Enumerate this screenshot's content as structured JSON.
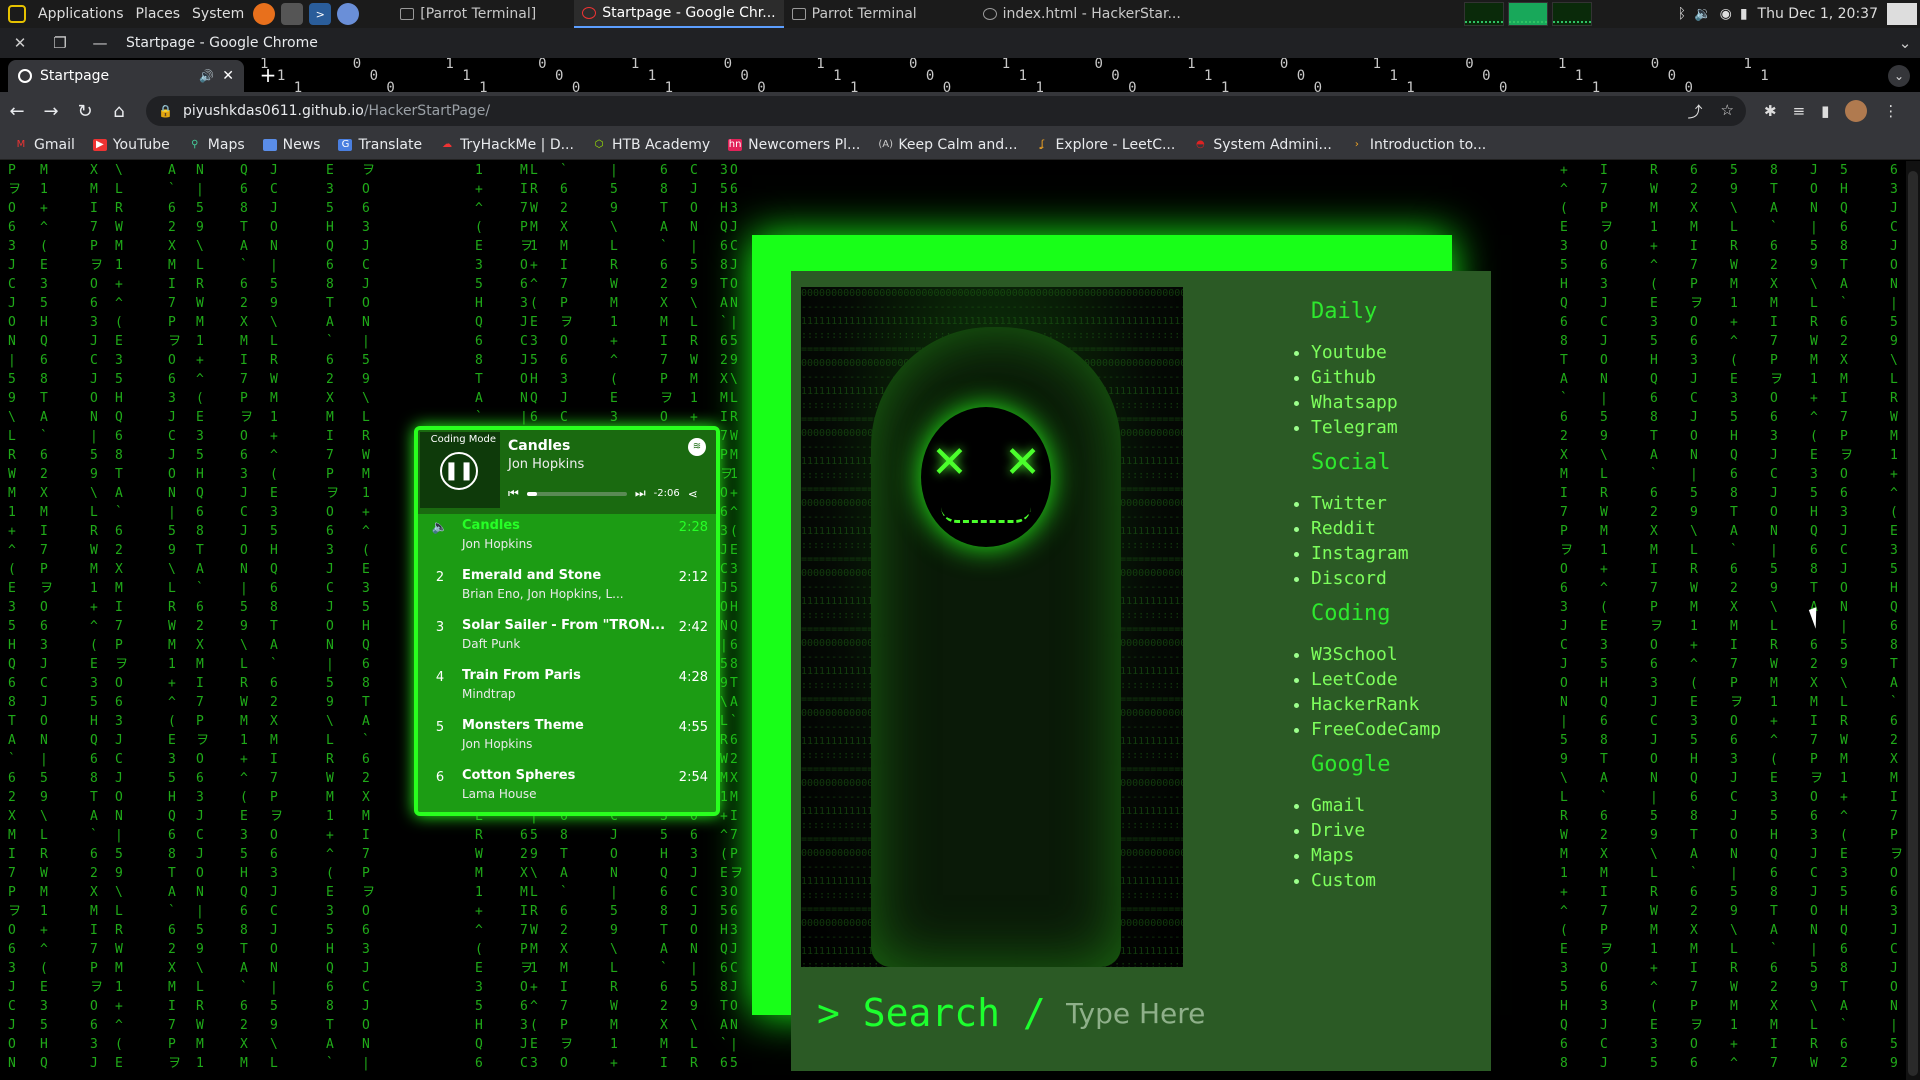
{
  "os_panel": {
    "menus": [
      "Applications",
      "Places",
      "System"
    ],
    "tasks": [
      {
        "label": "[Parrot Terminal]"
      },
      {
        "label": "Startpage - Google Chr..."
      },
      {
        "label": "Parrot Terminal"
      },
      {
        "label": "index.html - HackerStar..."
      }
    ],
    "clock": "Thu Dec 1, 20:37"
  },
  "chrome": {
    "window_title": "Startpage - Google Chrome",
    "tab_title": "Startpage",
    "url_host": "piyushkdas0611.github.io",
    "url_path": "/HackerStartPage/",
    "bookmarks": [
      "Gmail",
      "YouTube",
      "Maps",
      "News",
      "Translate",
      "TryHackMe | D...",
      "HTB Academy",
      "Newcomers Pl...",
      "Keep Calm and...",
      "Explore - LeetC...",
      "System Admini...",
      "Introduction to..."
    ]
  },
  "startpage": {
    "categories": [
      {
        "title": "Daily",
        "links": [
          "Youtube",
          "Github",
          "Whatsapp",
          "Telegram"
        ]
      },
      {
        "title": "Social",
        "links": [
          "Twitter",
          "Reddit",
          "Instagram",
          "Discord"
        ]
      },
      {
        "title": "Coding",
        "links": [
          "W3School",
          "LeetCode",
          "HackerRank",
          "FreeCodeCamp"
        ]
      },
      {
        "title": "Google",
        "links": [
          "Gmail",
          "Drive",
          "Maps",
          "Custom"
        ]
      }
    ],
    "search_prefix": "> Search /",
    "search_placeholder": "Type Here"
  },
  "player": {
    "cover_label": "Coding Mode",
    "now_playing_title": "Candles",
    "now_playing_artist": "Jon Hopkins",
    "remaining": "-2:06",
    "progress": 0.1,
    "tracks": [
      {
        "num": "",
        "title": "Candles",
        "artist": "Jon Hopkins",
        "duration": "2:28",
        "active": true
      },
      {
        "num": "2",
        "title": "Emerald and Stone",
        "artist": "Brian Eno, Jon Hopkins, L...",
        "duration": "2:12"
      },
      {
        "num": "3",
        "title": "Solar Sailer - From \"TRON...",
        "artist": "Daft Punk",
        "duration": "2:42"
      },
      {
        "num": "4",
        "title": "Train From Paris",
        "artist": "Mindtrap",
        "duration": "4:28"
      },
      {
        "num": "5",
        "title": "Monsters Theme",
        "artist": "Jon Hopkins",
        "duration": "4:55"
      },
      {
        "num": "6",
        "title": "Cotton Spheres",
        "artist": "Lama House",
        "duration": "2:54"
      }
    ]
  },
  "colors": {
    "matrix": "#26c81e",
    "glow": "#18ff18",
    "card_bg": "#2b5a25"
  }
}
